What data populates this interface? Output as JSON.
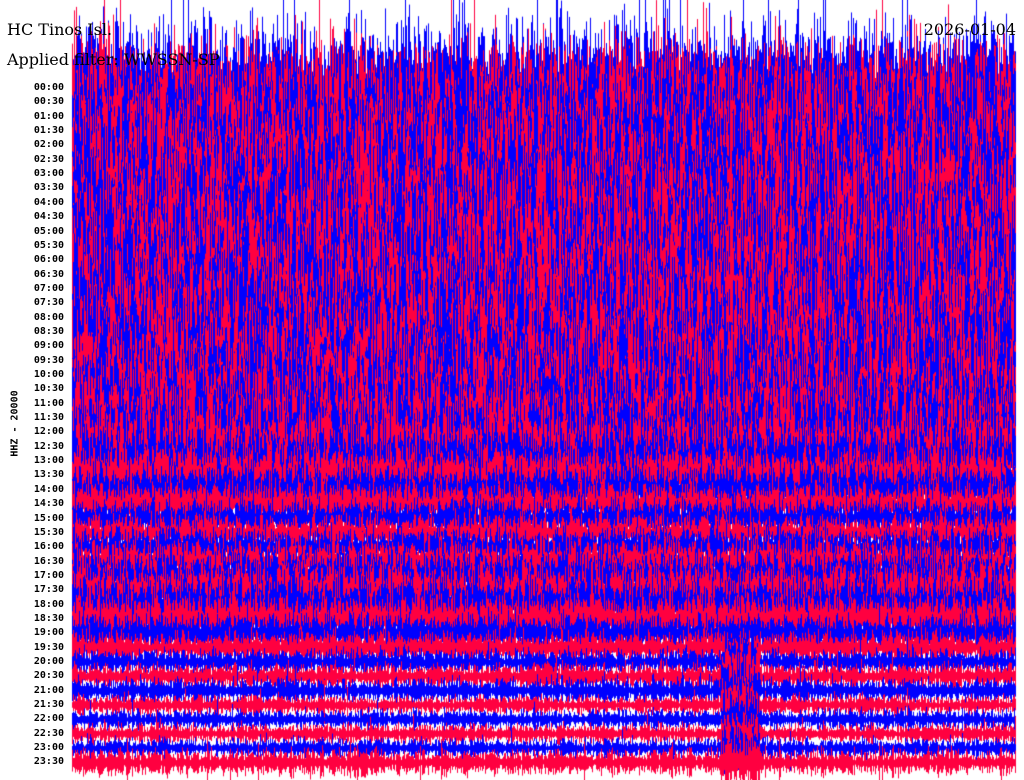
{
  "header": {
    "station": "HC Tinos Isl.",
    "filter": "Applied filter: WWSSN-SP",
    "date": "2026-01-04"
  },
  "chart_data": {
    "type": "helicorder",
    "title": "HC Tinos Isl.",
    "channel_scale_label": "HHZ - 20000",
    "row_labels": [
      "00:00",
      "00:30",
      "01:00",
      "01:30",
      "02:00",
      "02:30",
      "03:00",
      "03:30",
      "04:00",
      "04:30",
      "05:00",
      "05:30",
      "06:00",
      "06:30",
      "07:00",
      "07:30",
      "08:00",
      "08:30",
      "09:00",
      "09:30",
      "10:00",
      "10:30",
      "11:00",
      "11:30",
      "12:00",
      "12:30",
      "13:00",
      "13:30",
      "14:00",
      "14:30",
      "15:00",
      "15:30",
      "16:00",
      "16:30",
      "17:00",
      "17:30",
      "18:00",
      "18:30",
      "19:00",
      "19:30",
      "20:00",
      "20:30",
      "21:00",
      "21:30",
      "22:00",
      "22:30",
      "23:00",
      "23:30"
    ],
    "relative_amplitude": [
      1.0,
      1.0,
      1.0,
      1.0,
      1.0,
      1.0,
      1.0,
      1.0,
      1.0,
      1.0,
      1.0,
      1.0,
      1.0,
      1.0,
      1.0,
      1.0,
      1.0,
      0.95,
      0.95,
      0.9,
      0.9,
      0.85,
      0.85,
      0.8,
      0.75,
      0.7,
      0.6,
      0.5,
      0.4,
      0.35,
      0.3,
      0.3,
      0.3,
      0.35,
      0.4,
      0.45,
      0.45,
      0.4,
      0.3,
      0.25,
      0.2,
      0.2,
      0.2,
      0.15,
      0.15,
      0.15,
      0.15,
      0.2
    ],
    "colors": {
      "odd_rows": "#ff0040",
      "even_rows": "#0000ff"
    }
  }
}
